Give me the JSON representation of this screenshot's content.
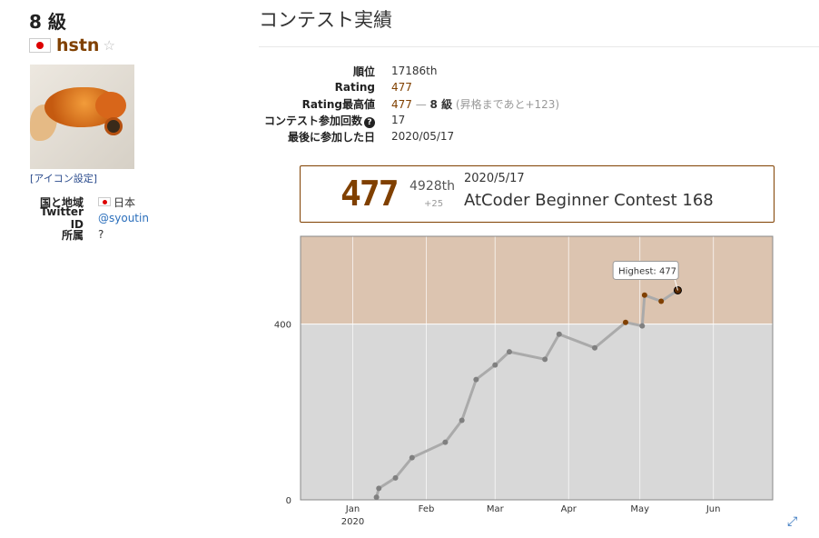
{
  "profile": {
    "rank_label": "8 級",
    "username": "hstn",
    "star": "☆",
    "icon_settings": "[アイコン設定]",
    "info": [
      {
        "key": "国と地域",
        "value": "日本",
        "flag": true
      },
      {
        "key": "Twitter ID",
        "value": "@syoutin",
        "link": true
      },
      {
        "key": "所属",
        "value": "?"
      }
    ]
  },
  "contest": {
    "heading": "コンテスト実績",
    "stats": {
      "rank_key": "順位",
      "rank_value": "17186th",
      "rating_key": "Rating",
      "rating_value": "477",
      "max_key": "Rating最高値",
      "max_value": "477",
      "max_sep": " — ",
      "max_kyu": "8 級",
      "max_note": "(昇格まであと+123)",
      "count_key": "コンテスト参加回数",
      "count_value": "17",
      "last_key": "最後に参加した日",
      "last_value": "2020/05/17"
    }
  },
  "card": {
    "rating": "477",
    "rank": "4928th",
    "diff": "+25",
    "date": "2020/5/17",
    "contest_name": "AtCoder Beginner Contest 168"
  },
  "chart_data": {
    "type": "line",
    "x_tick_labels": [
      "Jan",
      "Feb",
      "Mar",
      "Apr",
      "May",
      "Jun"
    ],
    "x_year_label": "2020",
    "y_tick_labels": [
      "0",
      "400"
    ],
    "ylim": [
      0,
      600
    ],
    "band_colors": {
      "gray": "#d8d8d8",
      "brown": "#dcc4b0"
    },
    "tooltip": "Highest: 477",
    "series": [
      {
        "points": [
          {
            "x": "2020-01-11",
            "y": 6
          },
          {
            "x": "2020-01-12",
            "y": 26
          },
          {
            "x": "2020-01-19",
            "y": 50
          },
          {
            "x": "2020-01-26",
            "y": 96
          },
          {
            "x": "2020-02-09",
            "y": 131
          },
          {
            "x": "2020-02-16",
            "y": 181
          },
          {
            "x": "2020-02-22",
            "y": 274
          },
          {
            "x": "2020-03-01",
            "y": 307
          },
          {
            "x": "2020-03-07",
            "y": 337
          },
          {
            "x": "2020-03-22",
            "y": 320
          },
          {
            "x": "2020-03-28",
            "y": 377
          },
          {
            "x": "2020-04-12",
            "y": 346
          },
          {
            "x": "2020-04-25",
            "y": 404
          },
          {
            "x": "2020-05-02",
            "y": 396
          },
          {
            "x": "2020-05-03",
            "y": 466
          },
          {
            "x": "2020-05-10",
            "y": 452
          },
          {
            "x": "2020-05-17",
            "y": 477
          }
        ]
      }
    ],
    "point_colors": {
      "gray": "#808080",
      "brown": "#804000"
    },
    "highlight_color": "#5a2a00"
  }
}
